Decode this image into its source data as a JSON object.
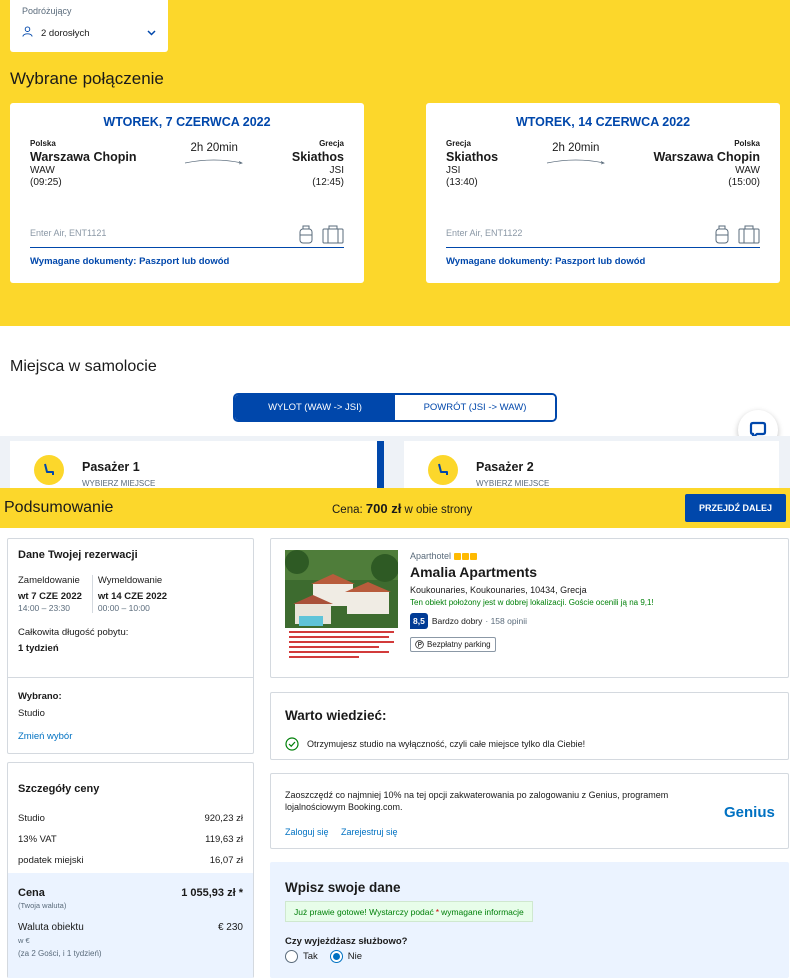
{
  "traveler": {
    "label": "Podróżujący",
    "value": "2 dorosłych"
  },
  "selected_title": "Wybrane połączenie",
  "flights": [
    {
      "date": "WTOREK, 7 CZERWCA 2022",
      "from_country": "Polska",
      "from_city": "Warszawa Chopin",
      "from_code": "WAW",
      "from_time": "(09:25)",
      "duration": "2h 20min",
      "to_country": "Grecja",
      "to_city": "Skiathos",
      "to_code": "JSI",
      "to_time": "(12:45)",
      "airline": "Enter Air, ENT1121",
      "docs": "Wymagane dokumenty: Paszport lub dowód"
    },
    {
      "date": "WTOREK, 14 CZERWCA 2022",
      "from_country": "Grecja",
      "from_city": "Skiathos",
      "from_code": "JSI",
      "from_time": "(13:40)",
      "duration": "2h 20min",
      "to_country": "Polska",
      "to_city": "Warszawa Chopin",
      "to_code": "WAW",
      "to_time": "(15:00)",
      "airline": "Enter Air, ENT1122",
      "docs": "Wymagane dokumenty: Paszport lub dowód"
    }
  ],
  "seats": {
    "title": "Miejsca w samolocie",
    "tab_out": "WYLOT (WAW -> JSI)",
    "tab_back": "POWRÓT (JSI -> WAW)",
    "passengers": [
      {
        "name": "Pasażer 1",
        "action": "WYBIERZ MIEJSCE"
      },
      {
        "name": "Pasażer 2",
        "action": "WYBIERZ MIEJSCE"
      }
    ]
  },
  "summary": {
    "title": "Podsumowanie",
    "price_label": "Cena:",
    "price_value": "700 zł",
    "price_suffix": "w obie strony",
    "next_button": "PRZEJDŹ DALEJ"
  },
  "booking": {
    "title": "Dane Twojej rezerwacji",
    "checkin_label": "Zameldowanie",
    "checkin_date": "wt 7 CZE 2022",
    "checkin_time": "14:00 – 23:30",
    "checkout_label": "Wymeldowanie",
    "checkout_date": "wt 14 CZE 2022",
    "checkout_time": "00:00 – 10:00",
    "stay_label": "Całkowita długość pobytu:",
    "stay_value": "1 tydzień",
    "chosen_label": "Wybrano:",
    "chosen_value": "Studio",
    "change_link": "Zmień wybór"
  },
  "price_details": {
    "title": "Szczegóły ceny",
    "rows": [
      {
        "label": "Studio",
        "value": "920,23 zł"
      },
      {
        "label": "13% VAT",
        "value": "119,63 zł"
      },
      {
        "label": "podatek miejski",
        "value": "16,07 zł"
      }
    ],
    "total_label": "Cena",
    "total_value": "1 055,93 zł *",
    "total_note": "(Twoja waluta)",
    "property_label": "Waluta obiektu",
    "property_value": "€ 230",
    "property_note1": "w €",
    "property_note2": "(za 2 Gości, i 1 tydzień)"
  },
  "hotel": {
    "type": "Aparthotel",
    "stars": 3,
    "name": "Amalia Apartments",
    "address": "Koukounaries, Koukounaries, 10434, Grecja",
    "location_note": "Ten obiekt położony jest w dobrej lokalizacji. Goście ocenili ją na 9,1!",
    "score": "8,5",
    "score_word": "Bardzo dobry",
    "reviews": "· 158 opinii",
    "parking": "Bezpłatny parking"
  },
  "worth": {
    "title": "Warto wiedzieć:",
    "line": "Otrzymujesz studio na wyłączność, czyli całe miejsce tylko dla Ciebie!"
  },
  "genius": {
    "text": "Zaoszczędź co najmniej 10% na tej opcji zakwaterowania po zalogowaniu z Genius, programem lojalnościowym Booking.com.",
    "login": "Zaloguj się",
    "register": "Zarejestruj się",
    "logo": "Genius"
  },
  "form": {
    "title": "Wpisz swoje dane",
    "note_pre": "Już prawie gotowe! Wystarczy podać",
    "note_star": "*",
    "note_post": "wymagane informacje",
    "question": "Czy wyjeżdżasz służbowo?",
    "opt_yes": "Tak",
    "opt_no": "Nie",
    "selected": "Nie"
  },
  "colors": {
    "accent": "#0047ab",
    "yellow": "#fcd72b",
    "booking_blue": "#0071c2",
    "green": "#008009"
  }
}
